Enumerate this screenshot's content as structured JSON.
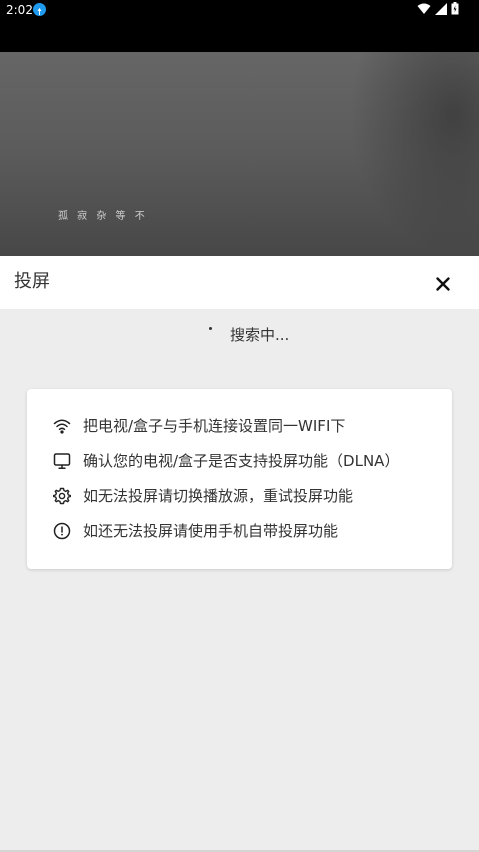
{
  "status_bar": {
    "time": "2:02",
    "icons": [
      "notification-icon",
      "wifi-icon",
      "signal-icon",
      "battery-icon"
    ]
  },
  "video": {
    "caption": "孤  寂  杂 等 不"
  },
  "header": {
    "title": "投屏",
    "close_icon": "close-icon"
  },
  "search": {
    "status": "搜索中..."
  },
  "tips": [
    {
      "icon": "wifi-icon",
      "text": "把电视/盒子与手机连接设置同一WIFI下"
    },
    {
      "icon": "monitor-icon",
      "text": "确认您的电视/盒子是否支持投屏功能（DLNA）"
    },
    {
      "icon": "gear-icon",
      "text": "如无法投屏请切换播放源，重试投屏功能"
    },
    {
      "icon": "info-icon",
      "text": "如还无法投屏请使用手机自带投屏功能"
    }
  ]
}
